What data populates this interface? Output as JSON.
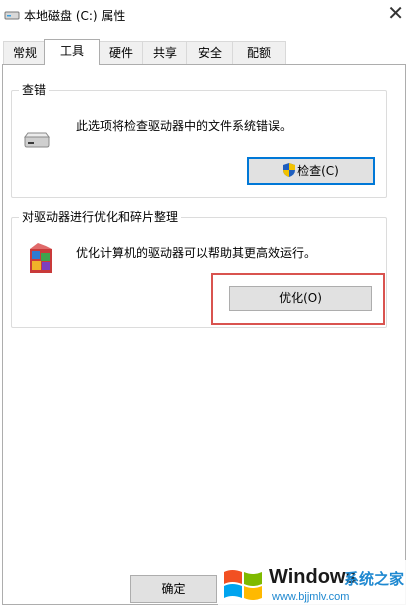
{
  "window": {
    "title": "本地磁盘 (C:) 属性",
    "close_symbol": "✕",
    "icon": "drive-icon"
  },
  "tabs": [
    {
      "label": "常规",
      "active": false
    },
    {
      "label": "工具",
      "active": true
    },
    {
      "label": "硬件",
      "active": false
    },
    {
      "label": "共享",
      "active": false
    },
    {
      "label": "安全",
      "active": false
    },
    {
      "label": "配额",
      "active": false
    }
  ],
  "error_check": {
    "group_label": "查错",
    "description": "此选项将检查驱动器中的文件系统错误。",
    "button_label": "检查(C)",
    "icon": "drive-icon",
    "button_icon": "shield-icon"
  },
  "optimize": {
    "group_label": "对驱动器进行优化和碎片整理",
    "description": "优化计算机的驱动器可以帮助其更高效运行。",
    "button_label": "优化(O)",
    "icon": "defrag-icon"
  },
  "footer": {
    "ok_label": "确定"
  },
  "watermark": {
    "windows_text": "Windows",
    "brand_text": "系统之家",
    "url_text": "www.bjjmlv.com"
  },
  "colors": {
    "accent_focus": "#0078d7",
    "highlight_box": "#d9534f",
    "button_face": "#e1e1e1",
    "brand_blue": "#1e88d0"
  }
}
